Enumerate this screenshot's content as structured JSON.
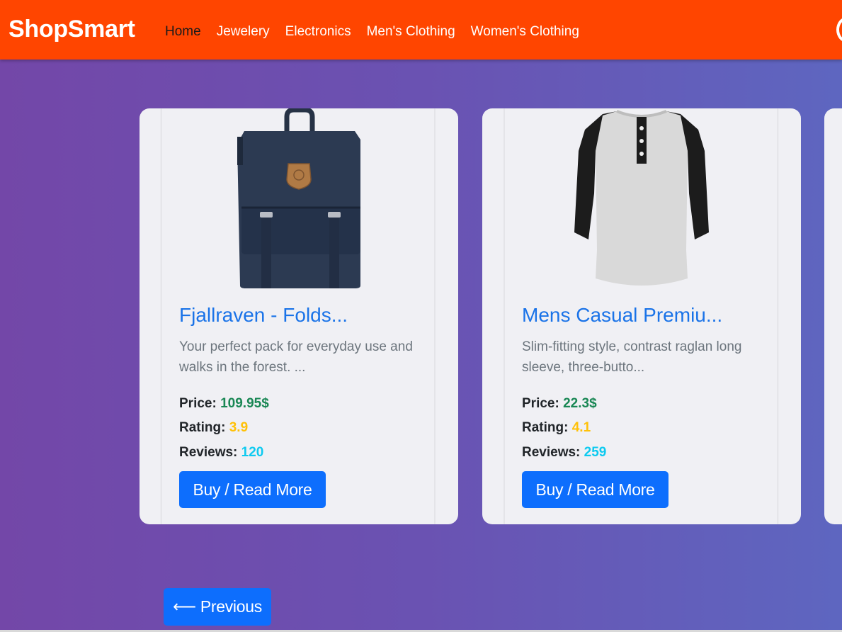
{
  "navbar": {
    "brand": "ShopSmart",
    "links": [
      "Home",
      "Jewelery",
      "Electronics",
      "Men's Clothing",
      "Women's Clothing"
    ],
    "active_link": "Home",
    "bg_color": "#ff4500"
  },
  "products": [
    {
      "title": "Fjallraven - Folds...",
      "description": "Your perfect pack for everyday use and walks in the forest. ...",
      "price_label": "Price:",
      "price": "109.95$",
      "rating_label": "Rating:",
      "rating": "3.9",
      "reviews_label": "Reviews:",
      "reviews": "120",
      "button": "Buy / Read More",
      "image": "backpack-image"
    },
    {
      "title": "Mens Casual Premiu...",
      "description": "Slim-fitting style, contrast raglan long sleeve, three-butto...",
      "price_label": "Price:",
      "price": "22.3$",
      "rating_label": "Rating:",
      "rating": "4.1",
      "reviews_label": "Reviews:",
      "reviews": "259",
      "button": "Buy / Read More",
      "image": "raglan-shirt-image"
    }
  ],
  "pagination": {
    "previous_label": "⟵ Previous"
  },
  "colors": {
    "accent": "#0d6efd",
    "title": "#1a73e8",
    "price": "#198754",
    "rating": "#ffc107",
    "reviews": "#0dcaf0"
  }
}
